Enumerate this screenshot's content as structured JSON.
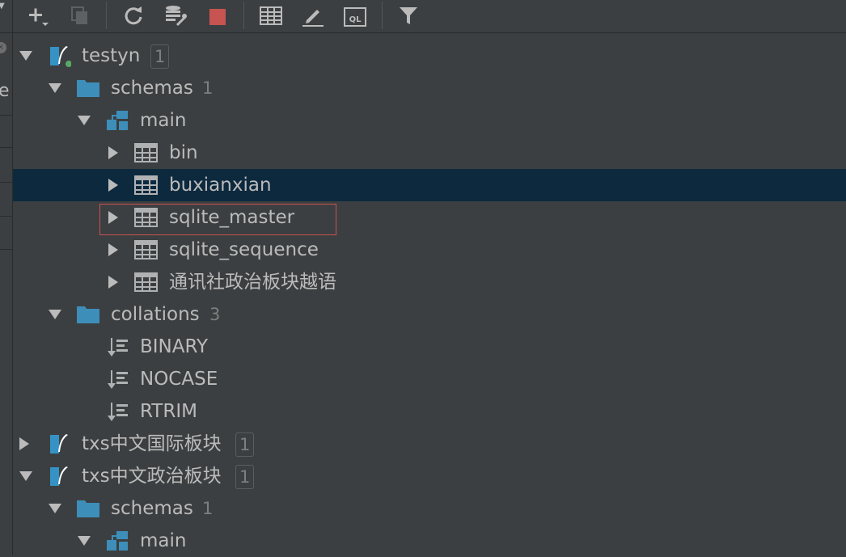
{
  "toolbar": {
    "buttons": [
      {
        "name": "add-button",
        "icon": "plus-dropdown-icon"
      },
      {
        "name": "duplicate-button",
        "icon": "copy-icon"
      },
      {
        "name": "refresh-button",
        "icon": "refresh-icon"
      },
      {
        "name": "db-settings-button",
        "icon": "database-wrench-icon"
      },
      {
        "name": "stop-button",
        "icon": "stop-icon"
      },
      {
        "name": "table-view-button",
        "icon": "table-icon"
      },
      {
        "name": "edit-button",
        "icon": "pencil-icon"
      },
      {
        "name": "sql-console-button",
        "icon": "ql-icon"
      },
      {
        "name": "filter-button",
        "icon": "filter-icon"
      }
    ]
  },
  "left_strip": {
    "letter": "e"
  },
  "tree": {
    "testyn": {
      "label": "testyn",
      "count": "1"
    },
    "schemas1": {
      "label": "schemas",
      "count": "1"
    },
    "main1": {
      "label": "main"
    },
    "tables": [
      "bin",
      "buxianxian",
      "sqlite_master",
      "sqlite_sequence",
      "通讯社政治板块越语"
    ],
    "collations": {
      "label": "collations",
      "count": "3"
    },
    "collation_items": [
      "BINARY",
      "NOCASE",
      "RTRIM"
    ],
    "db2": {
      "label": "txs中文国际板块",
      "count": "1"
    },
    "db3": {
      "label": "txs中文政治板块",
      "count": "1"
    },
    "schemas2": {
      "label": "schemas",
      "count": "1"
    },
    "main2": {
      "label": "main"
    }
  },
  "colors": {
    "background": "#3c3f41",
    "selection": "#0d293e",
    "highlight_border": "#c75450",
    "folder": "#3d8eb9",
    "datasource": "#3592c4",
    "stop": "#c75450"
  }
}
